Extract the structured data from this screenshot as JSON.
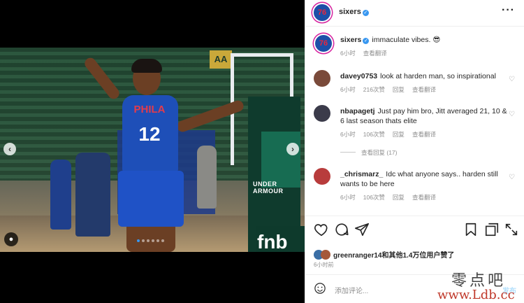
{
  "post": {
    "account": "sixers",
    "caption_user": "sixers",
    "caption": "immaculate vibes. 😎",
    "caption_time": "6小时",
    "caption_translate": "查看翻译",
    "media": {
      "jersey_text": "PHILA",
      "jersey_number": "12",
      "arena_sign": "AA",
      "sponsor_text": "UNDER ARMOUR",
      "sponsor_logo": "fnb"
    }
  },
  "header": {
    "more_icon": "more-horizontal-icon"
  },
  "comments": [
    {
      "user": "davey0753",
      "text": "look at harden man, so inspirational",
      "time": "6小时",
      "likes": "216次赞",
      "reply": "回复",
      "translate": "查看翻译"
    },
    {
      "user": "nbapagetj",
      "text": "Just pay him bro, Jitt averaged 21, 10 & 6 last season thats elite",
      "time": "6小时",
      "likes": "106次赞",
      "reply": "回复",
      "translate": "查看翻译",
      "view_replies": "查看回复 (17)"
    },
    {
      "user": "_chrismarz_",
      "text": "Idc what anyone says.. harden still wants to be here",
      "time": "6小时",
      "likes": "106次赞",
      "reply": "回复",
      "translate": "查看翻译"
    }
  ],
  "likes_line": "greenranger14和其他1.4万位用户赞了",
  "posted_time": "6小时前",
  "add_comment": {
    "placeholder": "添加评论...",
    "post_label": "发布"
  },
  "watermark": {
    "line1": "零点吧",
    "line2": "www.Ldb.cc"
  },
  "colors": {
    "verified": "#3897f0",
    "sixers_blue": "#1d4fa8",
    "sixers_red": "#e8283b"
  }
}
